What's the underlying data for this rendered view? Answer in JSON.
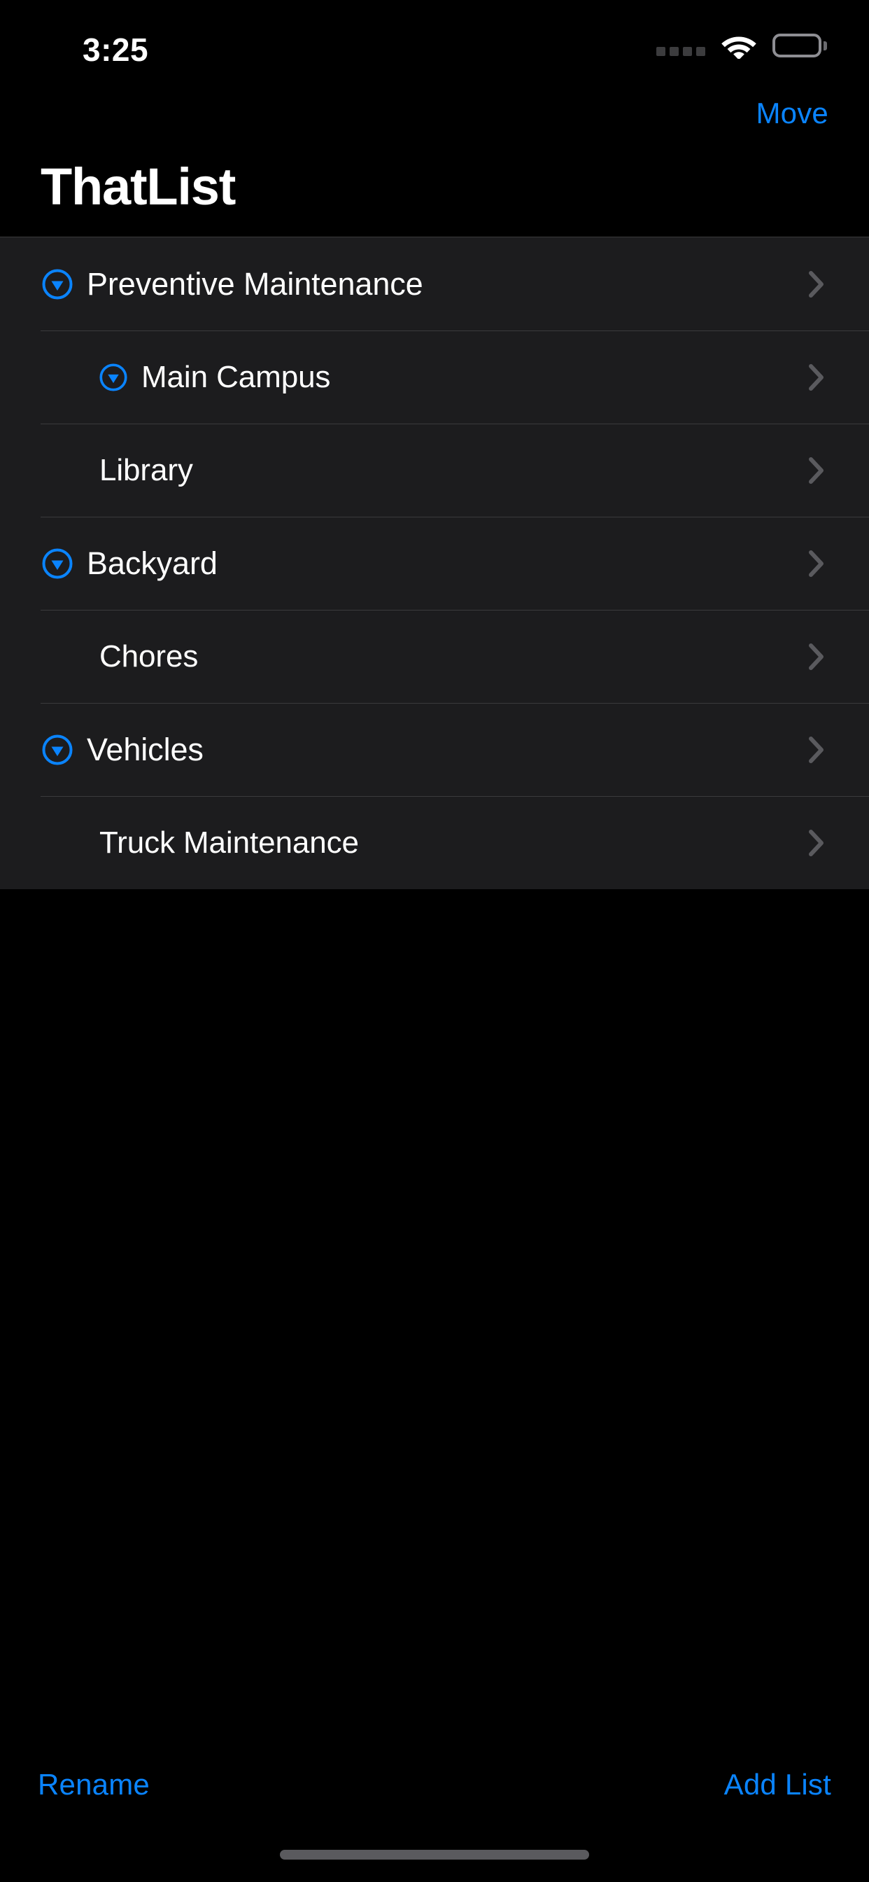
{
  "status_bar": {
    "time": "3:25",
    "cellular_icon": "cellular-dots-icon",
    "wifi_icon": "wifi-icon",
    "battery_icon": "battery-full-icon"
  },
  "nav": {
    "move_label": "Move",
    "title": "ThatList"
  },
  "colors": {
    "accent_blue": "#0a84ff",
    "row_background": "#1c1c1e",
    "separator": "#3a3a3c",
    "chevron_gray": "#5a5a5e",
    "page_background": "#000000"
  },
  "list": {
    "rows": [
      {
        "label": "Preventive Maintenance",
        "level": 0,
        "has_disclosure": true,
        "disclosure_state": "expanded",
        "chevron": "chevron-right-icon"
      },
      {
        "label": "Main Campus",
        "level": 1,
        "has_disclosure": true,
        "disclosure_state": "expanded",
        "chevron": "chevron-right-icon"
      },
      {
        "label": "Library",
        "level": 1,
        "has_disclosure": false,
        "disclosure_state": "",
        "chevron": "chevron-right-icon"
      },
      {
        "label": "Backyard",
        "level": 0,
        "has_disclosure": true,
        "disclosure_state": "expanded",
        "chevron": "chevron-right-icon"
      },
      {
        "label": "Chores",
        "level": 1,
        "has_disclosure": false,
        "disclosure_state": "",
        "chevron": "chevron-right-icon"
      },
      {
        "label": "Vehicles",
        "level": 0,
        "has_disclosure": true,
        "disclosure_state": "expanded",
        "chevron": "chevron-right-icon"
      },
      {
        "label": "Truck Maintenance",
        "level": 1,
        "has_disclosure": false,
        "disclosure_state": "",
        "chevron": "chevron-right-icon"
      }
    ]
  },
  "toolbar": {
    "rename_label": "Rename",
    "add_list_label": "Add List"
  }
}
